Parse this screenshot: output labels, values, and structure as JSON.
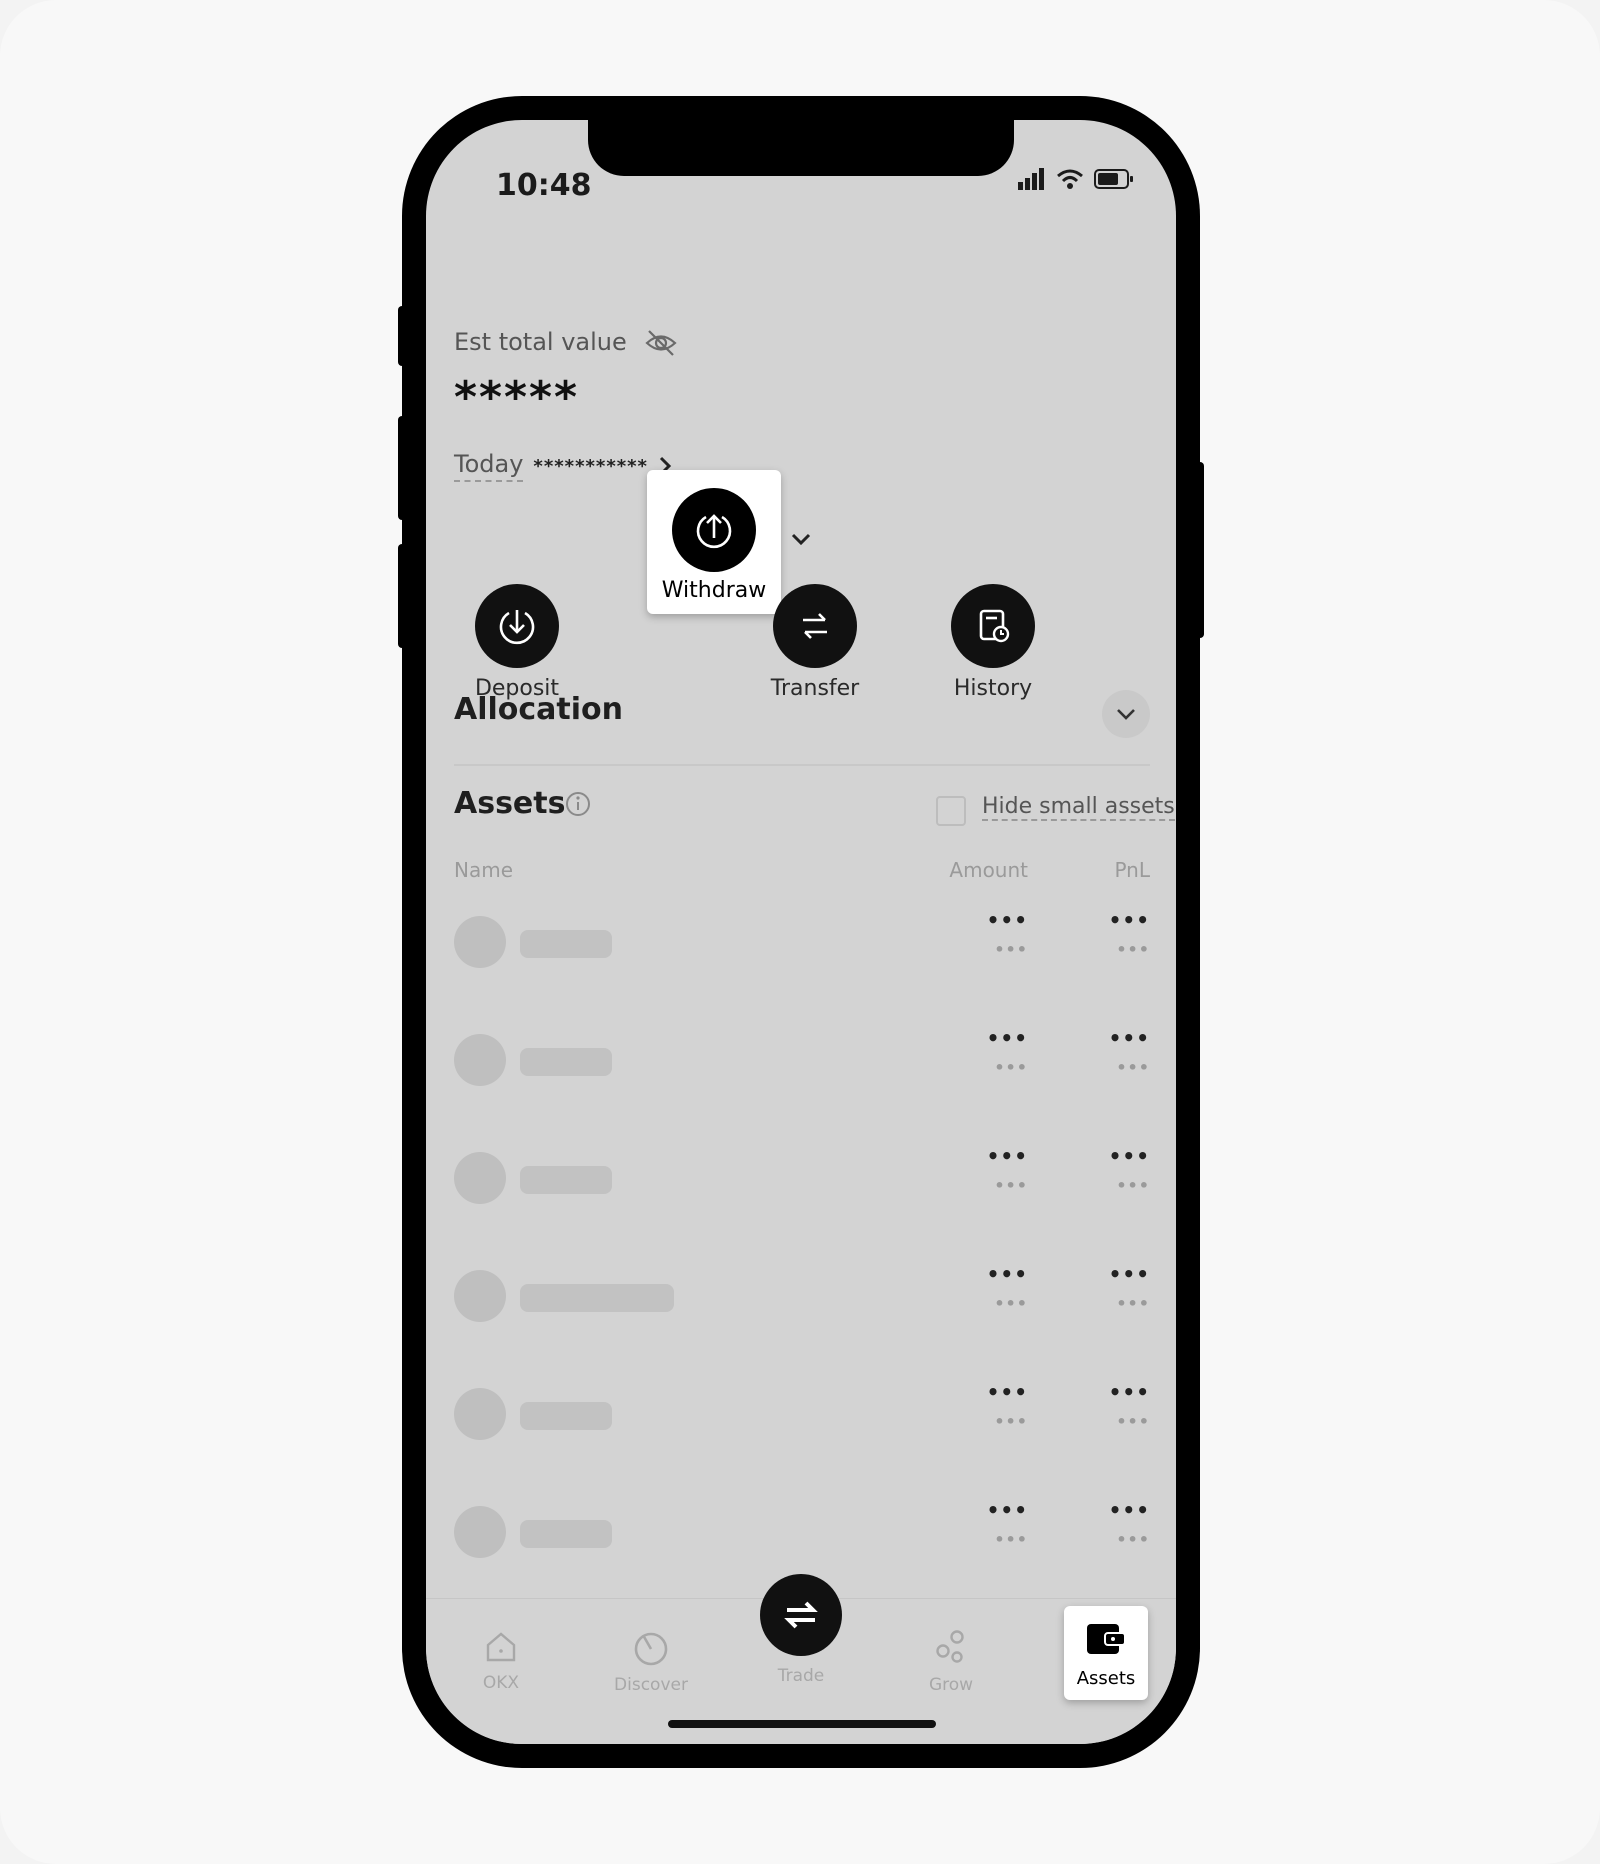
{
  "status_bar": {
    "time": "10:48"
  },
  "summary": {
    "est_total_label": "Est total value",
    "masked_total": "*****",
    "today_label": "Today",
    "today_value": "***********"
  },
  "actions": [
    {
      "label": "Deposit",
      "icon": "deposit-icon"
    },
    {
      "label": "Withdraw",
      "icon": "withdraw-icon",
      "highlighted": true
    },
    {
      "label": "Transfer",
      "icon": "transfer-icon"
    },
    {
      "label": "History",
      "icon": "history-icon"
    }
  ],
  "allocation": {
    "title": "Allocation"
  },
  "assets": {
    "title": "Assets",
    "hide_small_label": "Hide small assets",
    "hide_small_checked": false,
    "columns": {
      "name": "Name",
      "amount": "Amount",
      "pnl": "PnL"
    },
    "rows": [
      {
        "amount": "•••",
        "amount_sub": "•••",
        "pnl": "•••",
        "pnl_sub": "•••"
      },
      {
        "amount": "•••",
        "amount_sub": "•••",
        "pnl": "•••",
        "pnl_sub": "•••"
      },
      {
        "amount": "•••",
        "amount_sub": "•••",
        "pnl": "•••",
        "pnl_sub": "•••"
      },
      {
        "amount": "•••",
        "amount_sub": "•••",
        "pnl": "•••",
        "pnl_sub": "•••"
      },
      {
        "amount": "•••",
        "amount_sub": "•••",
        "pnl": "•••",
        "pnl_sub": "•••"
      },
      {
        "amount": "•••",
        "amount_sub": "•••",
        "pnl": "•••",
        "pnl_sub": "•••"
      }
    ]
  },
  "tabbar": {
    "tabs": [
      {
        "label": "OKX",
        "icon": "home-icon"
      },
      {
        "label": "Discover",
        "icon": "discover-icon"
      },
      {
        "label": "Trade",
        "icon": "trade-swap-icon"
      },
      {
        "label": "Grow",
        "icon": "grow-icon"
      },
      {
        "label": "Assets",
        "icon": "wallet-icon",
        "active": true
      }
    ]
  },
  "colors": {
    "screen_bg": "#d3d3d3",
    "highlight_bg": "#ffffff",
    "accent": "#111111"
  }
}
